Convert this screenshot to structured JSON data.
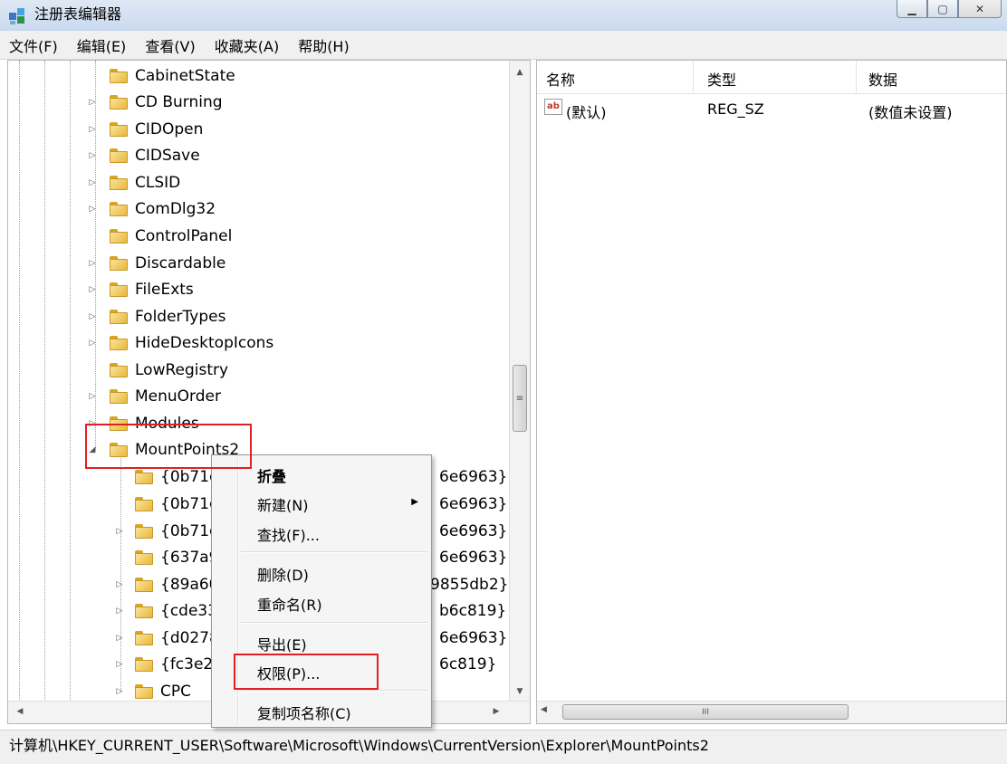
{
  "window": {
    "title": "注册表编辑器",
    "controls": {
      "minimize": "▁",
      "maximize": "▢",
      "close": "✕"
    }
  },
  "menu": [
    "文件(F)",
    "编辑(E)",
    "查看(V)",
    "收藏夹(A)",
    "帮助(H)"
  ],
  "tree": {
    "items": [
      {
        "label": "CabinetState",
        "expander": ""
      },
      {
        "label": "CD Burning",
        "expander": "▷"
      },
      {
        "label": "CIDOpen",
        "expander": "▷"
      },
      {
        "label": "CIDSave",
        "expander": "▷"
      },
      {
        "label": "CLSID",
        "expander": "▷"
      },
      {
        "label": "ComDlg32",
        "expander": "▷"
      },
      {
        "label": "ControlPanel",
        "expander": ""
      },
      {
        "label": "Discardable",
        "expander": "▷"
      },
      {
        "label": "FileExts",
        "expander": "▷"
      },
      {
        "label": "FolderTypes",
        "expander": "▷"
      },
      {
        "label": "HideDesktopIcons",
        "expander": "▷"
      },
      {
        "label": "LowRegistry",
        "expander": ""
      },
      {
        "label": "MenuOrder",
        "expander": "▷"
      },
      {
        "label": "Modules",
        "expander": "▷"
      },
      {
        "label": "MountPoints2",
        "expander": "◢"
      }
    ],
    "children": [
      {
        "label": "{0b71c",
        "tail": "6e6963}",
        "expander": ""
      },
      {
        "label": "{0b71c",
        "tail": "6e6963}",
        "expander": ""
      },
      {
        "label": "{0b71c",
        "tail": "6e6963}",
        "expander": "▷"
      },
      {
        "label": "{637a9",
        "tail": "6e6963}",
        "expander": ""
      },
      {
        "label": "{89a60",
        "tail": "9855db2}",
        "expander": "▷"
      },
      {
        "label": "{cde33",
        "tail": "b6c819}",
        "expander": "▷"
      },
      {
        "label": "{d0278",
        "tail": "6e6963}",
        "expander": "▷"
      },
      {
        "label": "{fc3e2",
        "tail": "6c819}",
        "expander": "▷"
      },
      {
        "label": "CPC",
        "tail": "",
        "expander": "▷"
      }
    ],
    "scroll": {
      "up": "▲",
      "down": "▼",
      "grip": "≡",
      "left": "◀",
      "right": "▶"
    }
  },
  "list": {
    "columns": [
      "名称",
      "类型",
      "数据"
    ],
    "rows": [
      {
        "icon": "ab",
        "name": "(默认)",
        "type": "REG_SZ",
        "data": "(数值未设置)"
      }
    ],
    "scroll": {
      "left": "◀",
      "right": "▶",
      "grip": "III"
    }
  },
  "context_menu": {
    "items": [
      {
        "label": "折叠",
        "bold": true
      },
      {
        "label": "新建(N)",
        "submenu": "▶"
      },
      {
        "label": "查找(F)..."
      },
      {
        "label": "删除(D)"
      },
      {
        "label": "重命名(R)"
      },
      {
        "label": "导出(E)"
      },
      {
        "label": "权限(P)..."
      },
      {
        "label": "复制项名称(C)"
      }
    ]
  },
  "statusbar": {
    "path": "计算机\\HKEY_CURRENT_USER\\Software\\Microsoft\\Windows\\CurrentVersion\\Explorer\\MountPoints2"
  },
  "colors": {
    "highlight": "#e02020",
    "folder": "#e7b83a",
    "selection": "#e5eef9"
  }
}
